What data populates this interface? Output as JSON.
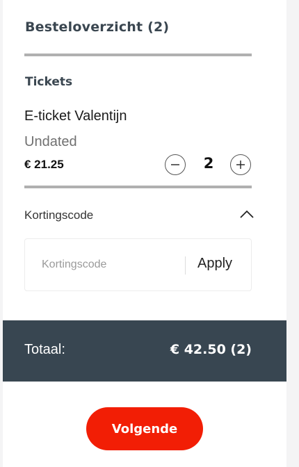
{
  "summary": {
    "title": "Besteloverzicht (2)"
  },
  "tickets": {
    "heading": "Tickets",
    "item": {
      "name": "E-ticket Valentijn",
      "date": "Undated",
      "price": "€ 21.25",
      "quantity": "2"
    }
  },
  "discount": {
    "label": "Kortingscode",
    "placeholder": "Kortingscode",
    "value": "",
    "apply_label": "Apply",
    "expanded": true
  },
  "total": {
    "label": "Totaal:",
    "value": "€ 42.50 (2)"
  },
  "footer": {
    "next_label": "Volgende"
  },
  "colors": {
    "accent": "#f21e05",
    "total_bar": "#384651",
    "heading": "#3a4650",
    "divider": "#b0b0b0"
  },
  "icons": {
    "decrease": "minus-icon",
    "increase": "plus-icon",
    "collapse": "chevron-up-icon"
  }
}
